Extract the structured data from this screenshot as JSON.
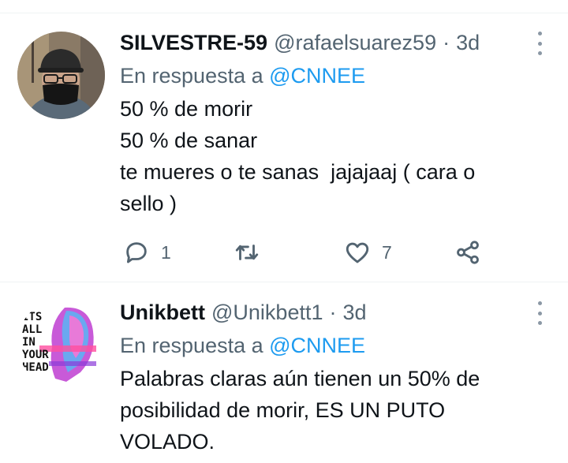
{
  "tweets": [
    {
      "name": "SILVESTRE-59",
      "handle": "@rafaelsuarez59",
      "separator": "·",
      "time": "3d",
      "reply_prefix": "En respuesta a",
      "reply_mention": "@CNNEE",
      "text": "50 % de morir\n50 % de sanar\nte mueres o te sanas  jajajaaj ( cara o\nsello )",
      "actions": {
        "reply_count": "1",
        "retweet_count": "",
        "like_count": "7"
      }
    },
    {
      "name": "Unikbett",
      "handle": "@Unikbett1",
      "separator": "·",
      "time": "3d",
      "reply_prefix": "En respuesta a",
      "reply_mention": "@CNNEE",
      "text": "Palabras claras aún tienen un 50% de\nposibilidad de morir, ES UN PUTO\nVOLADO.",
      "avatar_art_text": [
        "ITS",
        "ALL",
        "IN",
        "YOUR",
        "HEAD"
      ]
    }
  ],
  "icons": {
    "reply": "reply-bubble-icon",
    "retweet": "retweet-arrows-icon",
    "like": "heart-icon",
    "share": "share-icon",
    "more": "more-dots-icon"
  },
  "colors": {
    "link": "#1d9bf0",
    "secondary_text": "#536471",
    "primary_text": "#0f1419",
    "divider": "#eff3f4"
  }
}
